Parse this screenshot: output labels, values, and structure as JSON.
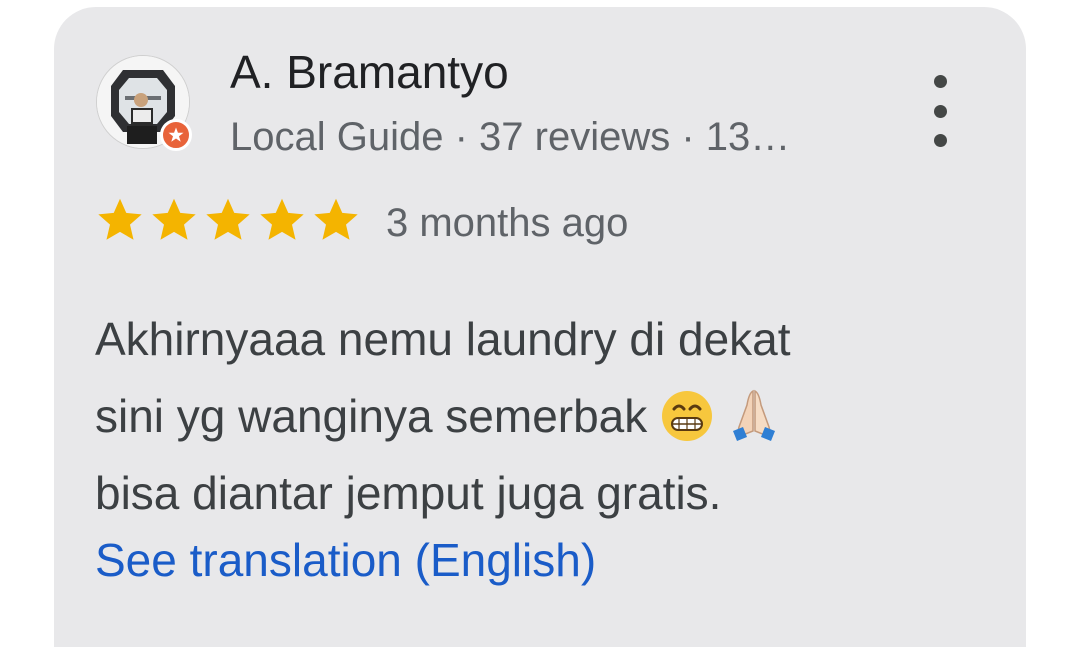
{
  "review": {
    "reviewer_name": "A. Bramantyo",
    "reviewer_meta": "Local Guide · 37 reviews · 13…",
    "rating": 5,
    "max_rating": 5,
    "date": "3 months ago",
    "text_lines": [
      "Akhirnyaaa nemu laundry di dekat",
      "sini yg wanginya semerbak",
      "bisa diantar jemput juga gratis."
    ],
    "emojis": [
      "grinning-face-emoji",
      "folded-hands-emoji"
    ],
    "translation_link": "See translation (English)"
  },
  "icons": {
    "more": "more-vert-icon",
    "star": "star-icon",
    "local_guide_badge": "local-guide-badge-icon"
  },
  "colors": {
    "card_bg": "#e8e8ea",
    "star": "#f4b400",
    "link": "#1a5cc8",
    "badge": "#e8633a",
    "name_text": "#202124",
    "secondary_text": "#5f6368"
  }
}
